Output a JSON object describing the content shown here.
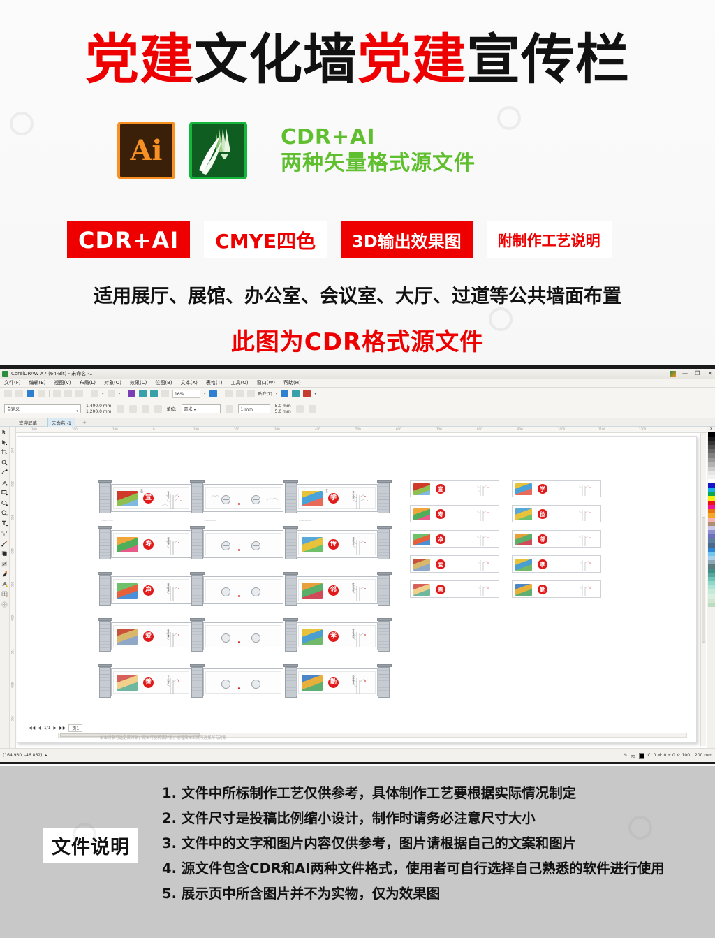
{
  "promo": {
    "title_parts": [
      {
        "text": "党建",
        "color": "#ee0000"
      },
      {
        "text": "文化墙",
        "color": "#111111"
      },
      {
        "text": " 党建",
        "color": "#ee0000"
      },
      {
        "text": "宣传栏",
        "color": "#111111"
      }
    ],
    "title_red_1": "党建",
    "title_black_1": "文化墙",
    "title_red_2": "党建",
    "title_black_2": "宣传栏",
    "ai_logo_label": "Ai",
    "cdr_logo_label": "CorelDRAW",
    "format_line_1": "CDR+AI",
    "format_line_2": "两种矢量格式源文件",
    "badges": [
      {
        "label": "CDR+AI",
        "style": "fill"
      },
      {
        "label": "CMYE四色",
        "style": "ghost"
      },
      {
        "label": "3D输出效果图",
        "style": "fill"
      },
      {
        "label": "附制作工艺说明",
        "style": "ghost"
      }
    ],
    "subline": "适用展厅、展馆、办公室、会议室、大厅、过道等公共墙面布置",
    "redline": "此图为CDR格式源文件",
    "colors": {
      "red": "#ee0000",
      "green": "#5fbf2e",
      "black": "#111111"
    }
  },
  "app": {
    "titlebar": "CorelDRAW X7 (64-Bit) - 未命名 -1",
    "window_controls": [
      "最小化",
      "还原",
      "关闭"
    ],
    "menus": [
      "文件(F)",
      "编辑(E)",
      "视图(V)",
      "布局(L)",
      "对象(O)",
      "效果(C)",
      "位图(B)",
      "文本(X)",
      "表格(T)",
      "工具(O)",
      "窗口(W)",
      "帮助(H)"
    ],
    "toolbar": {
      "zoom_value": "16%",
      "snap_label": "贴齐(T)"
    },
    "property_bar": {
      "page_preset": "自定义",
      "page_width": "1,400.0 mm",
      "page_height": "1,200.0 mm",
      "unit_label": "单位:",
      "unit_value": "毫米",
      "nudge_value": "1 mm",
      "duplicate_x": "5.0 mm",
      "duplicate_y": "5.0 mm"
    },
    "tabs": [
      {
        "label": "欢迎屏幕",
        "active": false
      },
      {
        "label": "未命名 -1",
        "active": true
      }
    ],
    "tab_add": "+",
    "ruler_h_ticks": [
      "300",
      "200",
      "100",
      "0",
      "100",
      "200",
      "300",
      "400",
      "500",
      "600",
      "700",
      "800",
      "900",
      "1000",
      "1100",
      "1200"
    ],
    "ruler_v_ticks": [
      "100",
      "200",
      "300",
      "400",
      "500",
      "600",
      "700",
      "800",
      "900"
    ],
    "toolbox_icons": [
      "pick-tool-icon",
      "shape-tool-icon",
      "crop-tool-icon",
      "zoom-tool-icon",
      "freehand-tool-icon",
      "smart-fill-icon",
      "rectangle-tool-icon",
      "ellipse-tool-icon",
      "polygon-tool-icon",
      "text-tool-icon",
      "parallel-dimension-icon",
      "straight-line-connector-icon",
      "drop-shadow-icon",
      "transparency-icon",
      "color-eyedropper-icon",
      "interactive-fill-icon",
      "mesh-fill-icon",
      "add-tool-icon"
    ],
    "status": {
      "page_nav": "1/1",
      "page_tab": "页1",
      "coordinates": "(164.930, -46.862)",
      "hint": "单击对象可选定该对象；双击可旋转该对象；或者双击工具可选择所有对象",
      "outline_label": "无",
      "fill_color": "C: 0 M: 0 Y: 0 K: 100",
      "outline_width": ".200 mm"
    },
    "palette": {
      "top_label": "X",
      "swatches": [
        "#000000",
        "#1a1a1a",
        "#333333",
        "#4d4d4d",
        "#666666",
        "#808080",
        "#999999",
        "#b3b3b3",
        "#cccccc",
        "#e6e6e6",
        "#f2f2f2",
        "#ffffff",
        "#1414c8",
        "#17b0e8",
        "#0aa84a",
        "#f2ef12",
        "#ee1111",
        "#ee1596",
        "#e8740a",
        "#f5a623",
        "#f4b3b3",
        "#b08d6e",
        "#c9c8e8",
        "#8f8fd0",
        "#6f6fbf",
        "#5e7ea0",
        "#4a6a8c",
        "#2f86d4",
        "#6fc6ef",
        "#a8cfe6",
        "#8fa8b8",
        "#5d7d7d",
        "#3f8f86",
        "#55a69b",
        "#6fc3b4",
        "#8fd8c8",
        "#aee3d4",
        "#c6ead8",
        "#d8efdf",
        "#cfe6cf",
        "#bcdcc0"
      ]
    },
    "artwork": {
      "description": "党建文化墙效果图",
      "rows": [
        {
          "left_seal": "宣",
          "right_seal": "学"
        },
        {
          "left_seal": "寿",
          "right_seal": "传"
        },
        {
          "left_seal": "净",
          "right_seal": "邻"
        },
        {
          "left_seal": "爱",
          "right_seal": "孝"
        },
        {
          "left_seal": "善",
          "right_seal": "勤"
        }
      ],
      "mini_panels": [
        {
          "seal": "宣"
        },
        {
          "seal": "学"
        },
        {
          "seal": "寿"
        },
        {
          "seal": "俭"
        },
        {
          "seal": "净"
        },
        {
          "seal": "邻"
        },
        {
          "seal": "爱"
        },
        {
          "seal": "孝"
        },
        {
          "seal": "善"
        },
        {
          "seal": "勤"
        }
      ],
      "dimension_label": "1,400.0 mm"
    }
  },
  "footer": {
    "label": "文件说明",
    "notes": [
      "1. 文件中所标制作工艺仅供参考，具体制作工艺要根据实际情况制定",
      "2. 文件尺寸是投稿比例缩小设计，制作时请务必注意尺寸大小",
      "3. 文件中的文字和图片内容仅供参考，图片请根据自己的文案和图片",
      "4. 源文件包含CDR和AI两种文件格式，使用者可自行选择自己熟悉的软件进行使用",
      "5. 展示页中所含图片并不为实物，仅为效果图"
    ],
    "background_color": "#c8c8c8"
  }
}
